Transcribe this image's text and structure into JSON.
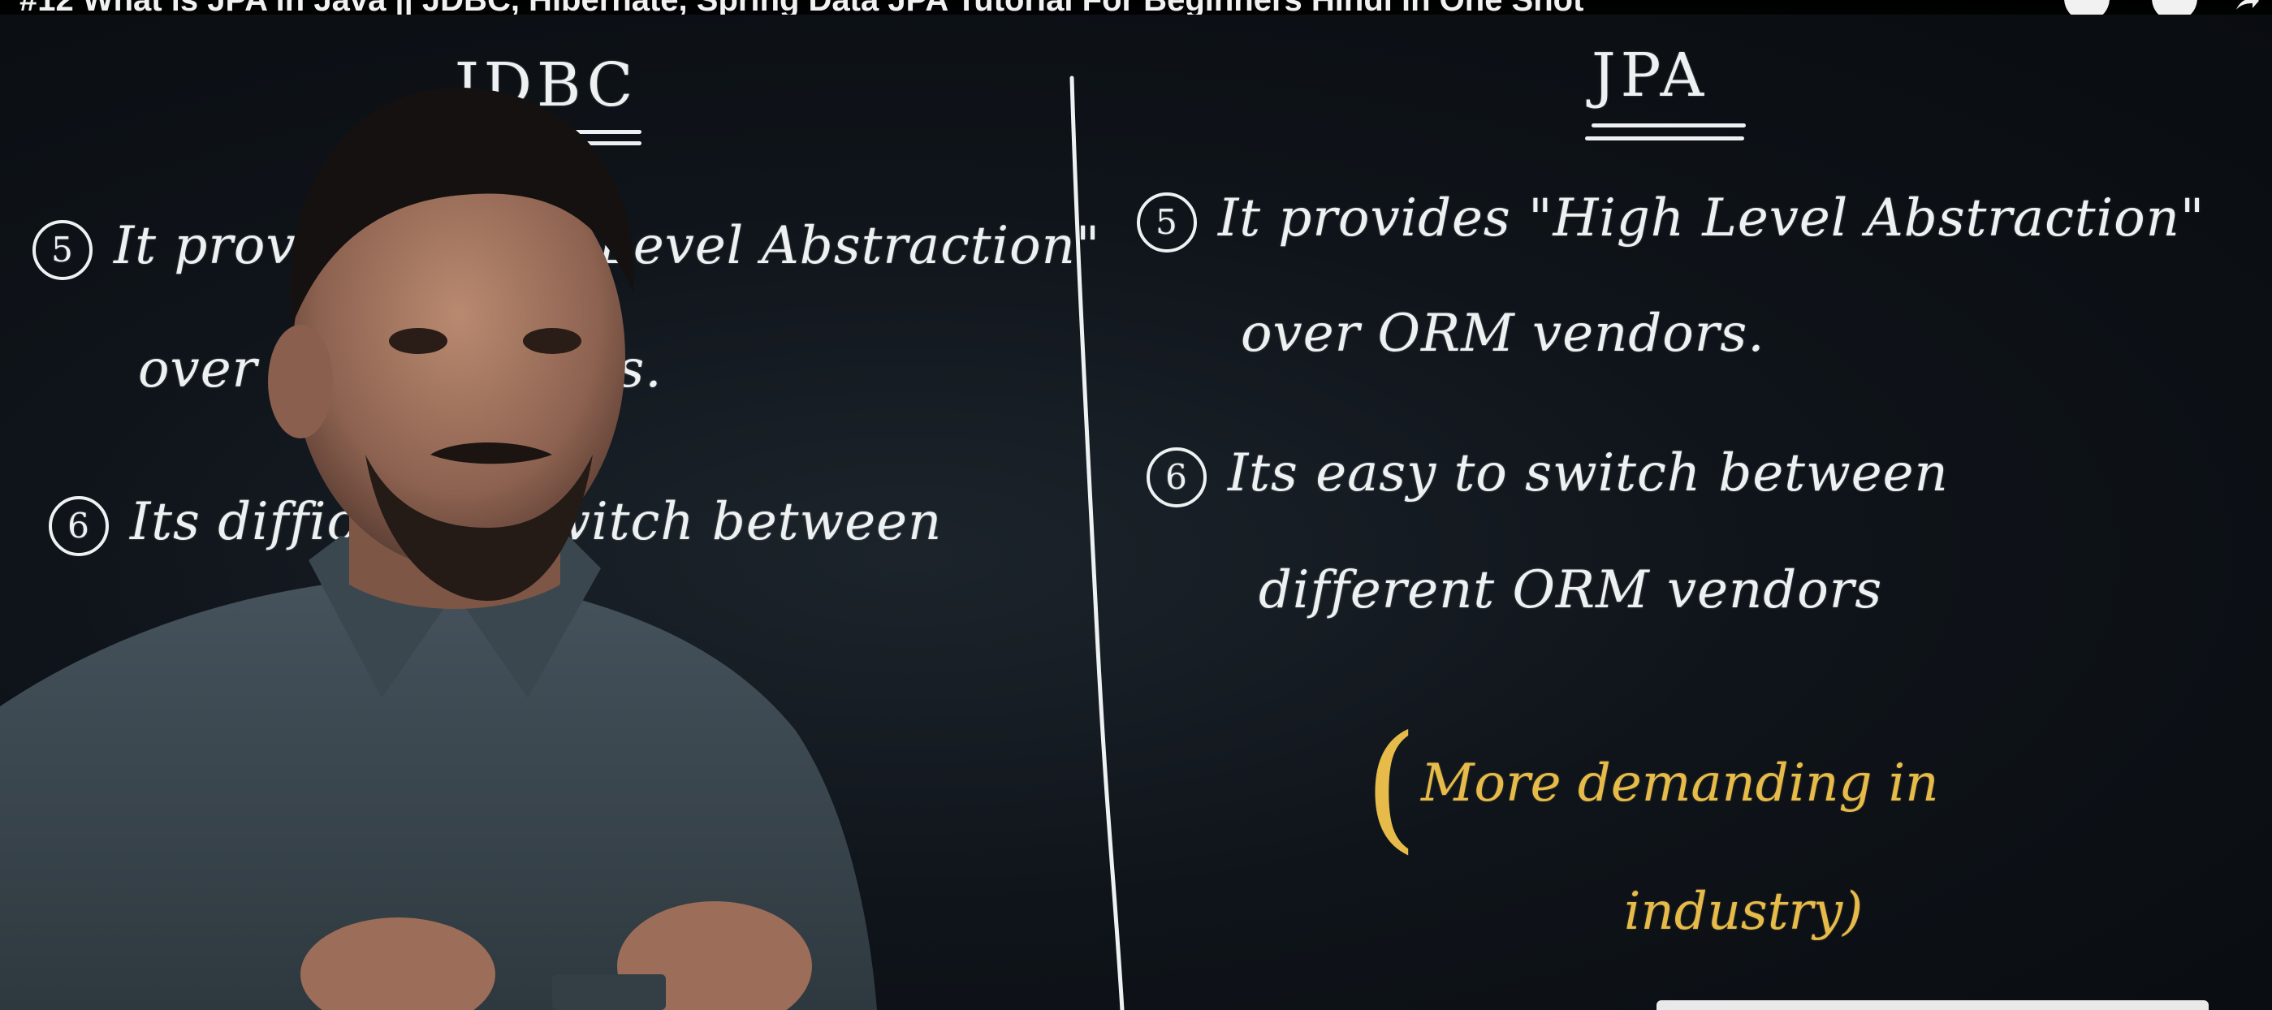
{
  "video": {
    "title": "#12 What is JPA in Java || JDBC, Hibernate, Spring Data JPA Tutorial For Beginners Hindi in One Shot"
  },
  "board": {
    "left": {
      "heading": "JDBC",
      "point5": {
        "number": "5",
        "line1": "It provides \"High Level Abstraction\"",
        "line2": "over ORM vendors."
      },
      "point6": {
        "number": "6",
        "line1": "Its difficult to switch between"
      }
    },
    "right": {
      "heading": "JPA",
      "point5": {
        "number": "5",
        "line1": "It provides \"High Level Abstraction\"",
        "line2": "over ORM vendors."
      },
      "point6": {
        "number": "6",
        "line1": "Its easy to switch between",
        "line2": "different ORM vendors"
      },
      "note": {
        "line1": "More demanding in",
        "line2": "industry)"
      }
    }
  },
  "colors": {
    "chalk": "#eef1f2",
    "highlight": "#e6bb4a",
    "board": "#0f141a"
  },
  "icons": [
    "more-button-icon",
    "search-icon",
    "share-icon"
  ]
}
